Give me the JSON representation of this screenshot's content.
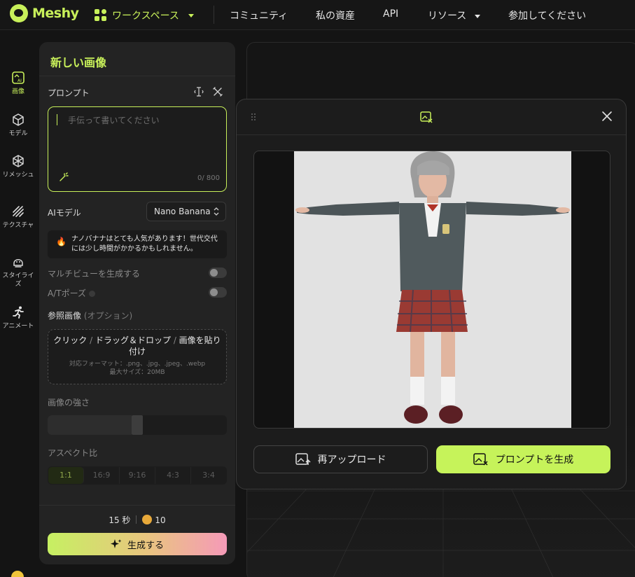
{
  "brand": {
    "name": "Meshy",
    "accent": "#c8f05a"
  },
  "nav": {
    "workspace": "ワークスペース",
    "community": "コミュニティ",
    "assets": "私の資産",
    "api": "API",
    "resources": "リソース",
    "join": "参加してください"
  },
  "rail": {
    "image": "画像",
    "model": "モデル",
    "remesh": "リメッシュ",
    "texture": "テクスチャ",
    "stylize": "スタイライズ",
    "animate": "アニメート"
  },
  "panel": {
    "title": "新しい画像",
    "prompt_label": "プロンプト",
    "prompt_placeholder": "手伝って書いてください",
    "prompt_value": "",
    "counter": "0/ 800",
    "ai_model_label": "AIモデル",
    "ai_model_value": "Nano Banana",
    "notice": "ナノバナナはとても人気があります！世代交代には少し時間がかかるかもしれません。",
    "multiview_label": "マルチビューを生成する",
    "multiview_on": false,
    "atpose_label": "A/Tポーズ",
    "atpose_on": false,
    "reference_label": "参照画像",
    "reference_optional": "(オプション)",
    "dropzone_click": "クリック",
    "dropzone_drag": "ドラッグ＆ドロップ",
    "dropzone_paste": "画像を貼り付け",
    "dropzone_formats": "対応フォーマット：.png、.jpg、.jpeg、.webp",
    "dropzone_maxsize": "最大サイズ：20MB",
    "strength_label": "画像の強さ",
    "strength_value": 0.5,
    "aspect_label": "アスペクト比",
    "aspect_options": [
      "1:1",
      "16:9",
      "9:16",
      "4:3",
      "3:4"
    ],
    "aspect_selected": "1:1",
    "time_cost": "15 秒",
    "credit_cost": "10",
    "generate_label": "生成する"
  },
  "modal": {
    "reupload_label": "再アップロード",
    "generate_prompt_label": "プロンプトを生成"
  },
  "icons": {
    "logo": "meshy-logo-icon",
    "workspace": "grid-icon",
    "image": "ai-image-icon",
    "model": "cube-icon",
    "remesh": "remesh-icon",
    "texture": "texture-icon",
    "stylize": "stylize-icon",
    "animate": "running-icon",
    "close": "close-icon",
    "wand": "magic-wand-icon",
    "sparkle": "sparkle-icon",
    "fire": "fire-icon"
  }
}
